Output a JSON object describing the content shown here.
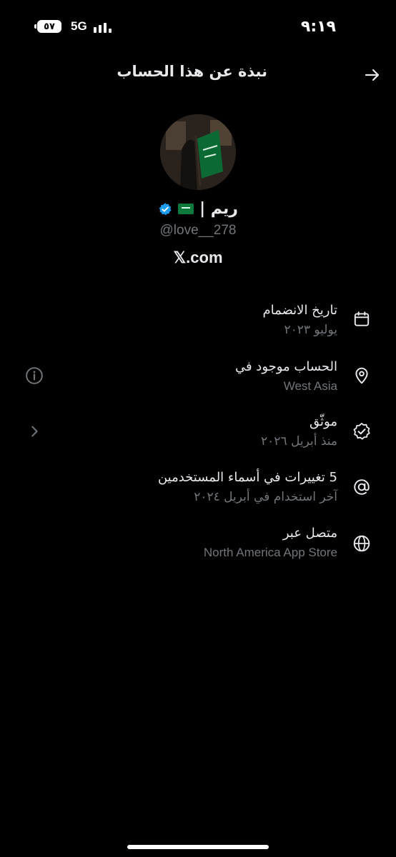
{
  "status_bar": {
    "battery": "٥٧",
    "network": "5G",
    "time": "٩:١٩"
  },
  "header": {
    "title": "نبذة عن هذا الحساب"
  },
  "profile": {
    "name": "ريم |",
    "handle": "@love__278",
    "site": "𝕏.com"
  },
  "info": [
    {
      "title": "تاريخ الانضمام",
      "subtitle": "يوليو ٢٠٢٣",
      "icon": "calendar-icon"
    },
    {
      "title": "الحساب موجود في",
      "subtitle": "West Asia",
      "icon": "location-pin-icon"
    },
    {
      "title": "موثّق",
      "subtitle": "منذ أبريل ٢٠٢٦",
      "icon": "verified-badge-icon"
    },
    {
      "title": "5 تغييرات في أسماء المستخدمين",
      "subtitle": "آخر استخدام في أبريل ٢٠٢٤",
      "icon": "at-sign-icon"
    },
    {
      "title": "متصل عبر",
      "subtitle": "North America App Store",
      "icon": "globe-icon"
    }
  ],
  "colors": {
    "background": "#000000",
    "text_primary": "#e7e9ea",
    "text_secondary": "#71767b",
    "verified_blue": "#1d9bf0",
    "flag_green": "#0b7a3b"
  }
}
